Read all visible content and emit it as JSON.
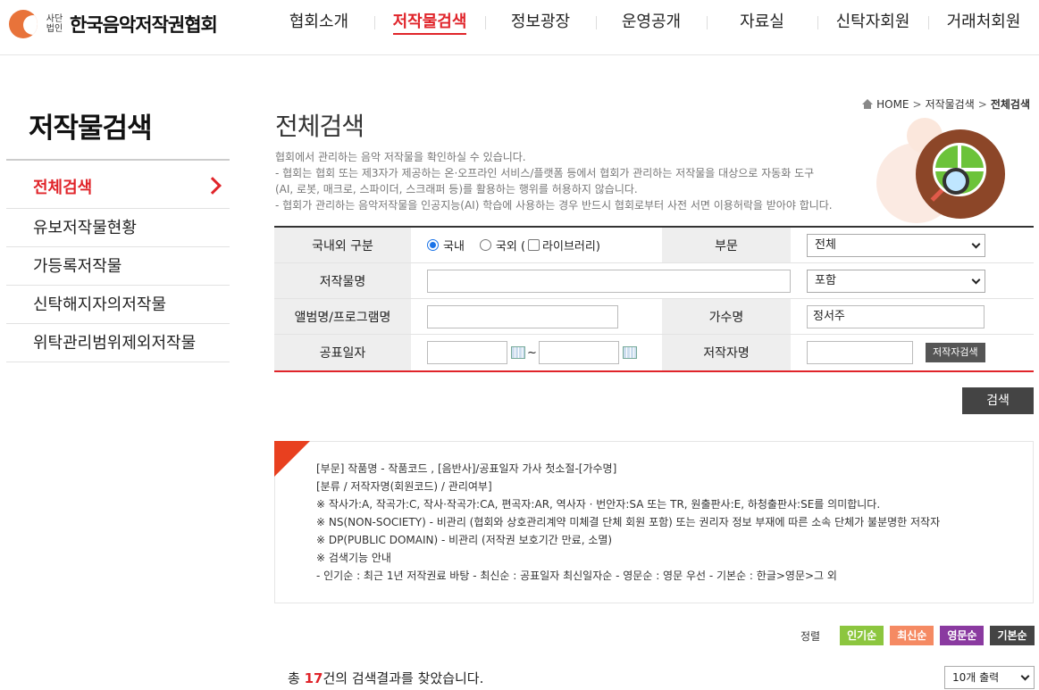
{
  "header": {
    "logo_sub": "사단법인",
    "logo_name": "한국음악저작권협회",
    "nav": [
      "협회소개",
      "저작물검색",
      "정보광장",
      "운영공개",
      "자료실",
      "신탁자회원",
      "거래처회원"
    ]
  },
  "sidebar": {
    "title": "저작물검색",
    "items": [
      "전체검색",
      "유보저작물현황",
      "가등록저작물",
      "신탁해지자의저작물",
      "위탁관리범위제외저작물"
    ]
  },
  "breadcrumb": {
    "home": "HOME",
    "level1": "저작물검색",
    "current": "전체검색"
  },
  "page_title": "전체검색",
  "description": [
    "협회에서 관리하는 음악 저작물을 확인하실 수 있습니다.",
    "- 협회는 협회 또는 제3자가 제공하는 온·오프라인 서비스/플랫폼 등에서 협회가 관리하는 저작물을 대상으로 자동화 도구",
    "(AI, 로봇, 매크로, 스파이더, 스크래퍼 등)를 활용하는 행위를 허용하지 않습니다.",
    "- 협회가 관리하는 음악저작물을 인공지능(AI) 학습에 사용하는 경우 반드시 협회로부터 사전 서면 이용허락을 받아야 합니다."
  ],
  "form": {
    "region_label": "국내외 구분",
    "region_domestic": "국내",
    "region_foreign": "국외 (",
    "library_label": "라이브러리)",
    "division_label": "부문",
    "division_value": "전체",
    "title_label": "저작물명",
    "title_value": "",
    "match_value": "포함",
    "album_label": "앨범명/프로그램명",
    "album_value": "",
    "singer_label": "가수명",
    "singer_value": "정서주",
    "date_label": "공표일자",
    "date_from": "",
    "date_sep": "~",
    "date_to": "",
    "author_label": "저작자명",
    "author_value": "",
    "author_search_button": "저작자검색"
  },
  "search_button": "검색",
  "info_lines": [
    "[부문] 작품명 - 작품코드 , [음반사]/공표일자 가사 첫소절-[가수명]",
    "[분류 / 저작자명(회원코드) / 관리여부]",
    "※ 작사가:A, 작곡가:C, 작사·작곡가:CA, 편곡자:AR, 역사자 · 번안자:SA 또는 TR, 원출판사:E, 하청출판사:SE를 의미합니다.",
    "※ NS(NON-SOCIETY) - 비관리 (협회와 상호관리계약 미체결 단체 회원 포함) 또는 권리자 정보 부재에 따른 소속 단체가 불분명한 저작자",
    "※ DP(PUBLIC DOMAIN) - 비관리 (저작권 보호기간 만료, 소멸)",
    "※ 검색기능 안내",
    "- 인기순 : 최근 1년 저작권료 바탕      - 최신순 : 공표일자 최신일자순      - 영문순 : 영문 우선      - 기본순 : 한글>영문>그 외"
  ],
  "sort": {
    "label": "정렬",
    "buttons": [
      {
        "label": "인기순",
        "color": "#8cc63f"
      },
      {
        "label": "최신순",
        "color": "#f58a63"
      },
      {
        "label": "영문순",
        "color": "#8a3aa0"
      },
      {
        "label": "기본순",
        "color": "#444444"
      }
    ]
  },
  "result": {
    "prefix": "총 ",
    "count": "17",
    "suffix": "건의 검색결과를 찾았습니다."
  },
  "per_page": "10개 출력"
}
